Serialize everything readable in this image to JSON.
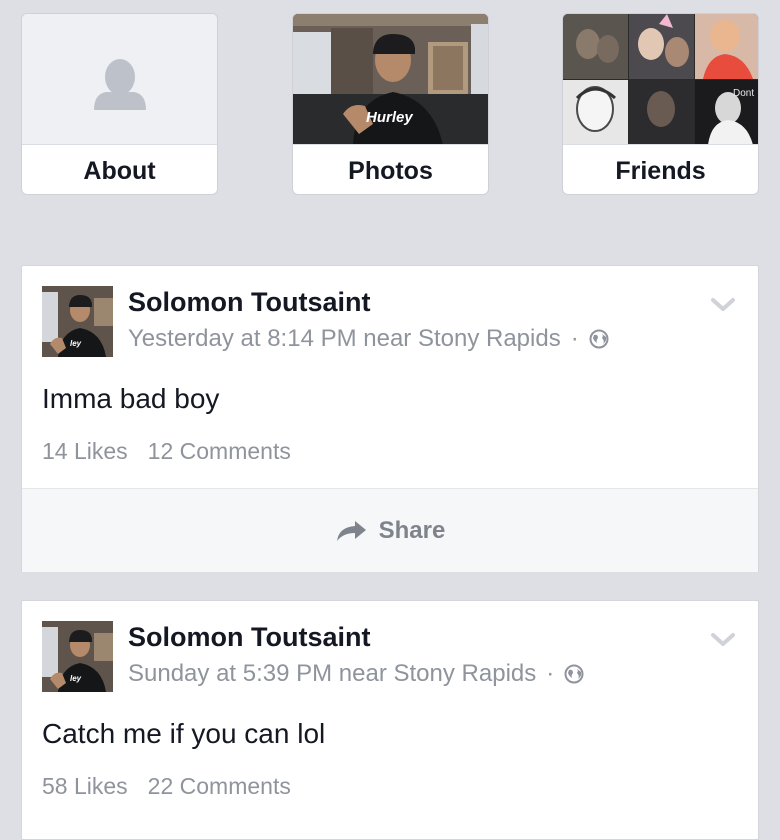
{
  "tiles": {
    "about": {
      "label": "About"
    },
    "photos": {
      "label": "Photos",
      "sweatshirt_text": "Hurley"
    },
    "friends": {
      "label": "Friends",
      "photo_caption": "Dont"
    }
  },
  "posts": [
    {
      "author": "Solomon Toutsaint",
      "meta": "Yesterday at 8:14 PM near Stony Rapids",
      "separator": "·",
      "text": "Imma bad boy",
      "likes": "14 Likes",
      "comments": "12 Comments",
      "share_label": "Share"
    },
    {
      "author": "Solomon Toutsaint",
      "meta": "Sunday at 5:39 PM near Stony Rapids",
      "separator": "·",
      "text": "Catch me if you can lol",
      "likes": "58 Likes",
      "comments": "22 Comments"
    }
  ],
  "icons": {
    "privacy": "globe-icon",
    "menu": "chevron-down-icon",
    "share": "share-arrow-icon",
    "placeholder": "person-silhouette-icon"
  },
  "colors": {
    "background": "#dddfe4",
    "text_primary": "#141823",
    "text_secondary": "#8f949c"
  }
}
